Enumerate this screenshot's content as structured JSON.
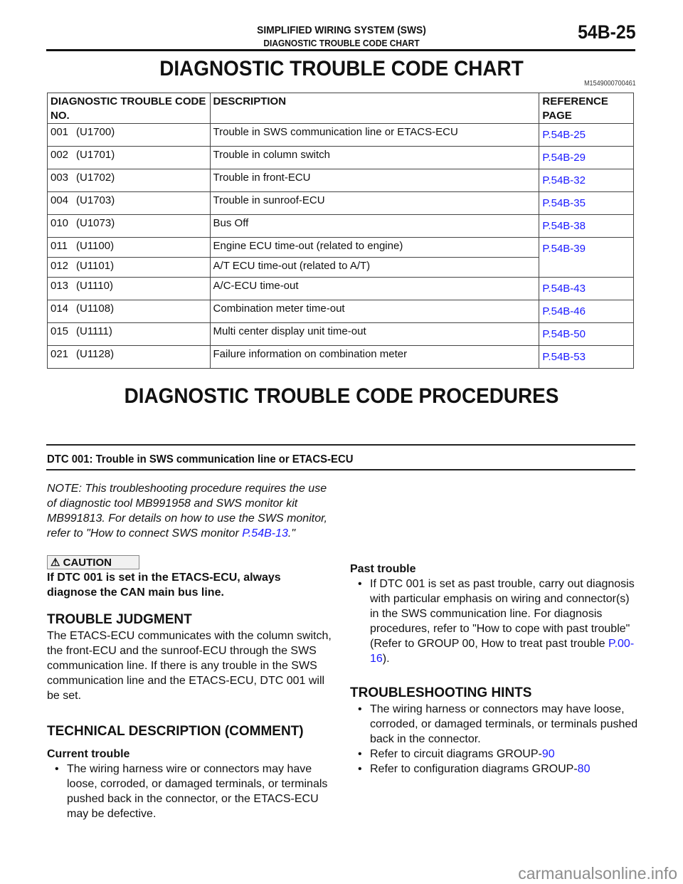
{
  "header": {
    "section": "SIMPLIFIED WIRING SYSTEM (SWS)",
    "subsection": "DIAGNOSTIC TROUBLE CODE CHART",
    "page_number": "54B-25"
  },
  "chart_heading": "DIAGNOSTIC TROUBLE CODE CHART",
  "doc_id": "M1549000700461",
  "table": {
    "headers": [
      "DIAGNOSTIC TROUBLE CODE NO.",
      "DESCRIPTION",
      "REFERENCE PAGE"
    ],
    "rows": [
      {
        "num": "001",
        "code": "(U1700)",
        "description": "Trouble in SWS communication line or ETACS-ECU",
        "ref": "P.54B-25"
      },
      {
        "num": "002",
        "code": "(U1701)",
        "description": "Trouble in column switch",
        "ref": "P.54B-29"
      },
      {
        "num": "003",
        "code": "(U1702)",
        "description": "Trouble in front-ECU",
        "ref": "P.54B-32"
      },
      {
        "num": "004",
        "code": "(U1703)",
        "description": "Trouble in sunroof-ECU",
        "ref": "P.54B-35"
      },
      {
        "num": "010",
        "code": "(U1073)",
        "description": "Bus Off",
        "ref": "P.54B-38"
      },
      {
        "num": "011",
        "code": "(U1100)",
        "description": "Engine ECU time-out (related to engine)",
        "ref": "P.54B-39"
      },
      {
        "num": "012",
        "code": "(U1101)",
        "description": "A/T ECU time-out (related to A/T)",
        "ref": ""
      },
      {
        "num": "013",
        "code": "(U1110)",
        "description": "A/C-ECU time-out",
        "ref": "P.54B-43"
      },
      {
        "num": "014",
        "code": "(U1108)",
        "description": "Combination meter time-out",
        "ref": "P.54B-46"
      },
      {
        "num": "015",
        "code": "(U1111)",
        "description": "Multi center display unit time-out",
        "ref": "P.54B-50"
      },
      {
        "num": "021",
        "code": "(U1128)",
        "description": "Failure information on combination meter",
        "ref": "P.54B-53"
      }
    ]
  },
  "procedures_heading": "DIAGNOSTIC TROUBLE CODE PROCEDURES",
  "dtc_title": "DTC 001: Trouble in SWS communication line or ETACS-ECU",
  "note": {
    "text": "NOTE: This troubleshooting procedure requires the use of diagnostic tool MB991958 and SWS monitor kit MB991813. For details on how to use the SWS monitor, refer to \"How to connect SWS monitor ",
    "link": "P.54B-13",
    "suffix": ".\""
  },
  "caution": {
    "icon": "warning-triangle-icon",
    "label": "CAUTION",
    "text": "If DTC 001 is set in the ETACS-ECU, always diagnose the CAN main bus line."
  },
  "trouble_judgment": {
    "heading": "TROUBLE JUDGMENT",
    "text": "The ETACS-ECU communicates with the column switch, the front-ECU and the sunroof-ECU through the SWS communication line. If there is any trouble in the SWS communication line and the ETACS-ECU, DTC 001 will be set."
  },
  "technical_description": {
    "heading": "TECHNICAL DESCRIPTION (COMMENT)",
    "current_label": "Current trouble",
    "current_items": [
      "The wiring harness wire or connectors may have loose, corroded, or damaged terminals, or terminals pushed back in the connector, or the ETACS-ECU may be defective."
    ],
    "past_label": "Past trouble",
    "past_text": "If DTC 001 is set as past trouble, carry out diagnosis with particular emphasis on wiring and connector(s) in the SWS communication line. For diagnosis procedures, refer to \"How to cope with past trouble\" (Refer to GROUP 00, How to treat past trouble ",
    "past_link": "P.00-16",
    "past_suffix": ")."
  },
  "troubleshooting_hints": {
    "heading": "TROUBLESHOOTING HINTS",
    "item1": "The wiring harness or connectors may have loose, corroded, or damaged terminals, or terminals pushed back in the connector.",
    "item2_text": "Refer to circuit diagrams GROUP-",
    "item2_link": "90",
    "item3_text": "Refer to configuration diagrams GROUP-",
    "item3_link": "80"
  },
  "watermark": "carmanualsonline.info"
}
